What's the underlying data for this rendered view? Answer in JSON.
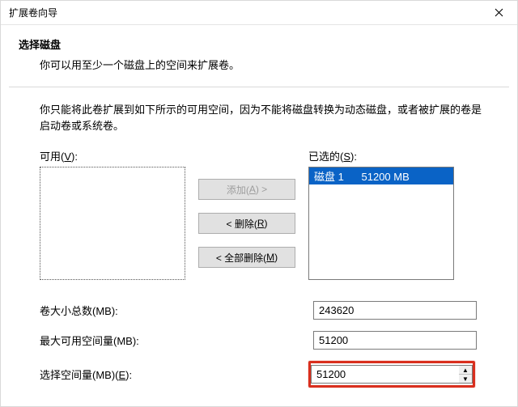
{
  "titlebar": {
    "title": "扩展卷向导"
  },
  "header": {
    "heading": "选择磁盘",
    "sub": "你可以用至少一个磁盘上的空间来扩展卷。"
  },
  "note": "你只能将此卷扩展到如下所示的可用空间，因为不能将磁盘转换为动态磁盘，或者被扩展的卷是启动卷或系统卷。",
  "available_label_pre": "可用(",
  "available_label_key": "V",
  "available_label_post": "):",
  "selected_label_pre": "已选的(",
  "selected_label_key": "S",
  "selected_label_post": "):",
  "buttons": {
    "add_pre": "添加(",
    "add_key": "A",
    "add_post": ") >",
    "remove_pre": "< 删除(",
    "remove_key": "R",
    "remove_post": ")",
    "removeall_pre": "< 全部删除(",
    "removeall_key": "M",
    "removeall_post": ")"
  },
  "selected_items": [
    {
      "text": "磁盘 1      51200 MB",
      "selected": true
    }
  ],
  "fields": {
    "total_label": "卷大小总数(MB):",
    "total_value": "243620",
    "max_label": "最大可用空间量(MB):",
    "max_value": "51200",
    "choose_label_pre": "选择空间量(MB)(",
    "choose_label_key": "E",
    "choose_label_post": "):",
    "choose_value": "51200"
  }
}
